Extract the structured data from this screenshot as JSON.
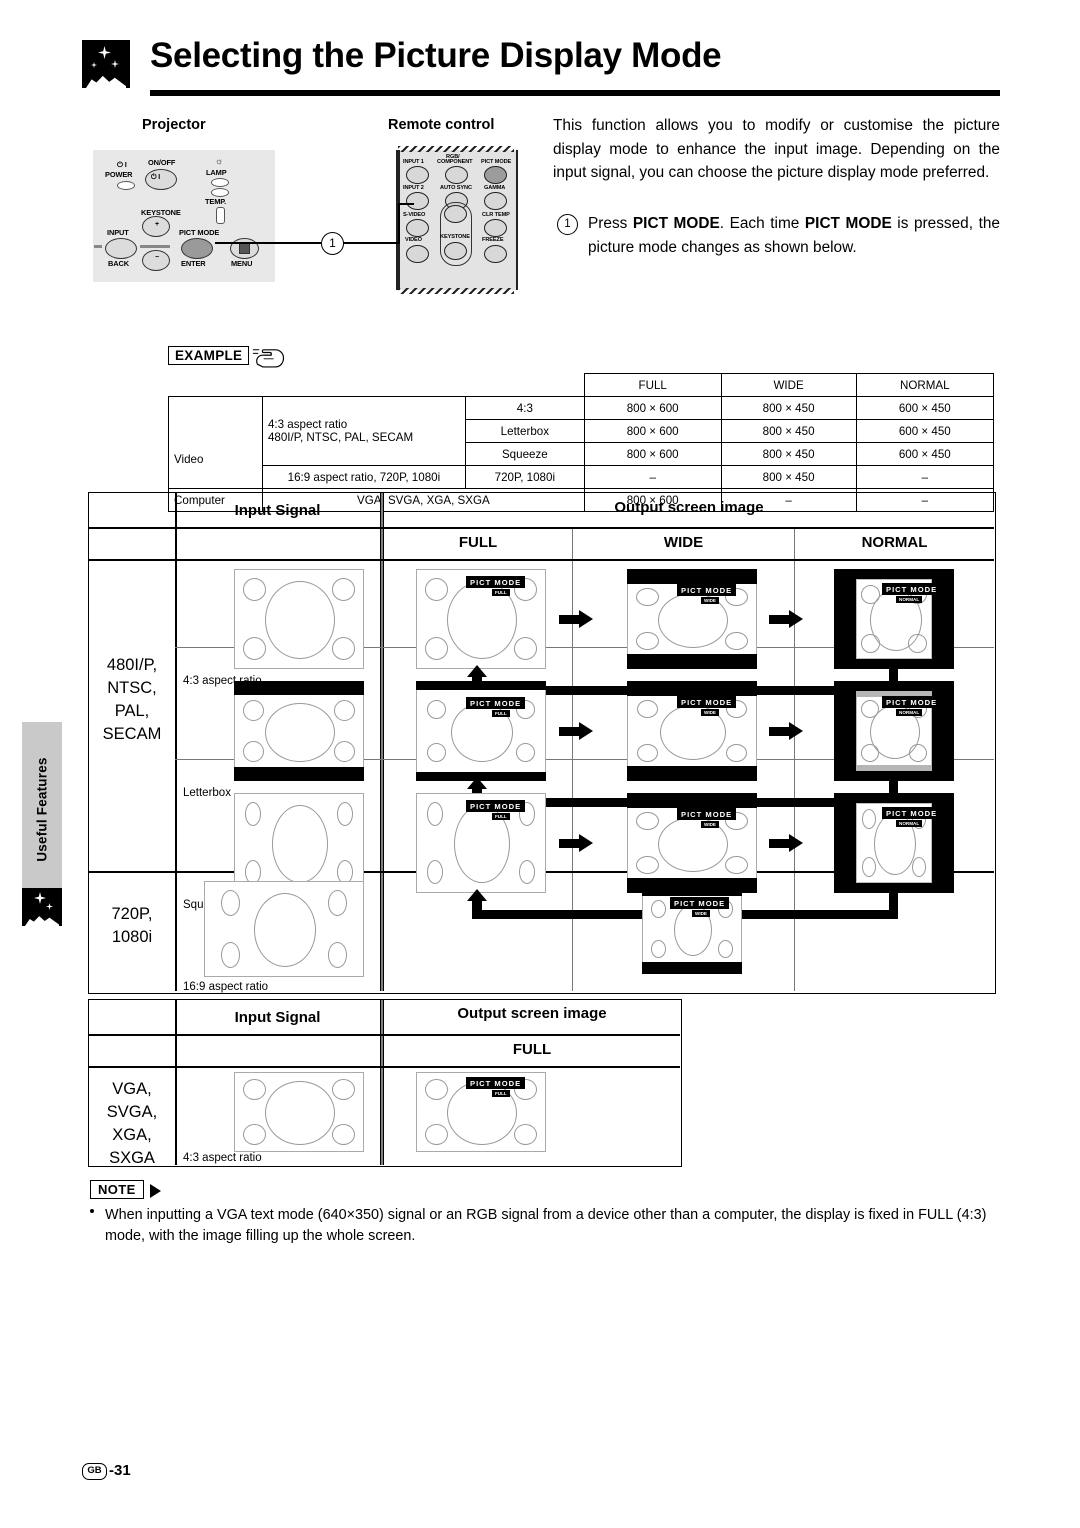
{
  "page": {
    "title": "Selecting the Picture Display Mode",
    "side_tab_label": "Useful Features",
    "footer_region": "GB",
    "footer_page": "-31"
  },
  "columns": {
    "projector_label": "Projector",
    "remote_label": "Remote control",
    "callout_number": "1"
  },
  "projector": {
    "power_symbol": "⏻ I",
    "power_label": "POWER",
    "onoff_label": "ON/OFF",
    "onoff_symbol": "⏻ I",
    "lamp_label": "LAMP",
    "temp_label": "TEMP.",
    "keystone_label": "KEYSTONE",
    "input_label": "INPUT",
    "pictmode_label": "PICT MODE",
    "back_label": "BACK",
    "enter_label": "ENTER",
    "menu_label": "MENU",
    "up_label": "+",
    "down_label": "−"
  },
  "remote": {
    "buttons": [
      "INPUT 1",
      "RGB/\nCOMPONENT",
      "PICT MODE",
      "INPUT 2",
      "AUTO SYNC",
      "GAMMA",
      "S-VIDEO",
      "KEYSTONE",
      "CLR TEMP",
      "VIDEO",
      "FREEZE"
    ],
    "label_input1": "INPUT 1",
    "label_rgb_l1": "RGB/",
    "label_rgb_l2": "COMPONENT",
    "label_pictmode": "PICT MODE",
    "label_input2": "INPUT 2",
    "label_autosync": "AUTO SYNC",
    "label_gamma": "GAMMA",
    "label_svideo": "S-VIDEO",
    "label_clrtemp": "CLR TEMP",
    "label_video": "VIDEO",
    "label_keystone": "KEYSTONE",
    "label_freeze": "FREEZE"
  },
  "intro": {
    "paragraph": "This function allows you to modify or customise the picture display mode to enhance the input image. Depending on the input signal, you can choose the picture display mode preferred.",
    "step_number": "1",
    "step_pre": "Press ",
    "step_key1": "PICT MODE",
    "step_mid": ". Each time ",
    "step_key2": "PICT MODE",
    "step_post": " is pressed, the picture mode changes as shown below."
  },
  "example": {
    "badge_label": "EXAMPLE",
    "table": {
      "headers": [
        "FULL",
        "WIDE",
        "NORMAL"
      ],
      "rows": [
        {
          "source": "Video",
          "signal": "4:3 aspect ratio\n480I/P, NTSC, PAL, SECAM",
          "mode": "4:3",
          "full": "800 × 600",
          "wide": "800 × 450",
          "normal": "600 × 450"
        },
        {
          "source": "",
          "signal": "",
          "mode": "Letterbox",
          "full": "800 × 600",
          "wide": "800 × 450",
          "normal": "600 × 450"
        },
        {
          "source": "",
          "signal": "",
          "mode": "Squeeze",
          "full": "800 × 600",
          "wide": "800 × 450",
          "normal": "600 × 450"
        },
        {
          "source": "",
          "signal": "16:9 aspect ratio, 720P, 1080i",
          "mode": "720P, 1080i",
          "full": "–",
          "wide": "800 × 450",
          "normal": "–"
        },
        {
          "source": "Computer",
          "signal": "VGA, SVGA, XGA, SXGA",
          "mode": "",
          "full": "800 × 600",
          "wide": "–",
          "normal": "–"
        }
      ],
      "signal_line1": "4:3 aspect ratio",
      "signal_line2": "480I/P, NTSC, PAL, SECAM",
      "signal_169": "16:9 aspect ratio, 720P, 1080i",
      "signal_computer": "VGA, SVGA, XGA, SXGA"
    }
  },
  "diagram": {
    "input_signal_header": "Input Signal",
    "output_header": "Output screen image",
    "mode_full": "FULL",
    "mode_wide": "WIDE",
    "mode_normal": "NORMAL",
    "video_signal_label": "480I/P,\nNTSC,\nPAL,\nSECAM",
    "video_signal_l1": "480I/P,",
    "video_signal_l2": "NTSC,",
    "video_signal_l3": "PAL,",
    "video_signal_l4": "SECAM",
    "hd_signal_l1": "720P,",
    "hd_signal_l2": "1080i",
    "pc_signal_l1": "VGA,",
    "pc_signal_l2": "SVGA,",
    "pc_signal_l3": "XGA,",
    "pc_signal_l4": "SXGA",
    "caption_43": "4:3 aspect ratio",
    "caption_letterbox": "Letterbox",
    "caption_squeeze": "Squeeze",
    "caption_169": "16:9 aspect ratio",
    "osd_title": "PICT MODE",
    "osd_full": "FULL",
    "osd_wide": "WIDE",
    "osd_normal": "NORMAL"
  },
  "diagram2": {
    "input_signal_header": "Input Signal",
    "output_header": "Output screen image",
    "mode_full": "FULL",
    "caption_43": "4:3 aspect ratio"
  },
  "note": {
    "badge_label": "NOTE",
    "text": "When inputting a VGA text mode (640×350) signal or an RGB signal from a device other than a computer, the display is fixed in FULL (4:3) mode, with the image filling up the whole screen."
  }
}
